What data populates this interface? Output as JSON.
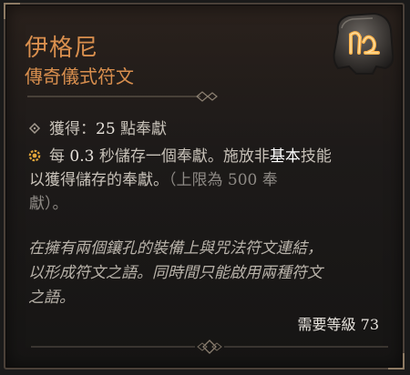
{
  "item": {
    "name": "伊格尼",
    "type": "傳奇儀式符文"
  },
  "effects": {
    "gain": {
      "prefix": "獲得：",
      "amount": "25",
      "suffix": " 點奉獻"
    },
    "passive": {
      "part1": "每 ",
      "interval": "0.3",
      "part2": " 秒儲存一個奉獻。施放非",
      "highlight": "基本",
      "part3": "技能",
      "line2": "以獲得儲存的奉獻。",
      "cap_open": "（上限為 ",
      "cap_value": "500",
      "cap_unit": " 奉",
      "cap_close": "獻）。"
    }
  },
  "flavor_text": {
    "line1": "在擁有兩個鑲孔的裝備上與咒法符文連結，",
    "line2": "以形成符文之語。同時間只能啟用兩種符文",
    "line3": "之語。"
  },
  "requirement": {
    "label": "需要等級 ",
    "level": "73"
  },
  "colors": {
    "title": "#d98f4e",
    "accent_bullet": "#e0a43a",
    "body_text": "#c7c1b8",
    "flavor_text": "#b9b3aa"
  },
  "icons": {
    "rune": "rune-glyph-icon",
    "gain_bullet": "diamond-bullet-icon",
    "passive_bullet": "gear-bullet-icon"
  }
}
